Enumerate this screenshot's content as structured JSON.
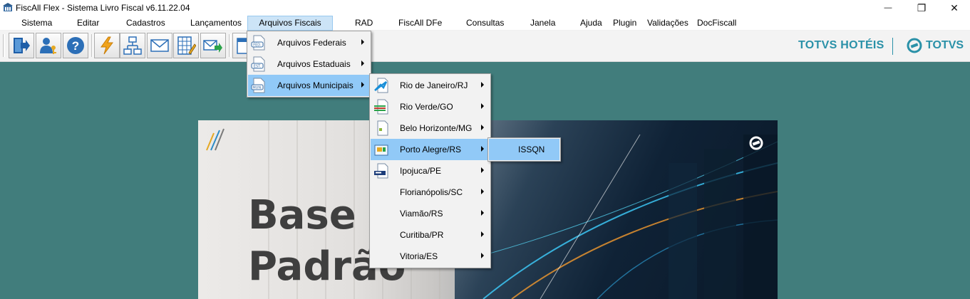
{
  "window": {
    "title": "FiscAll Flex - Sistema Livro Fiscal v6.11.22.04",
    "minimize_glyph": "—",
    "maximize_glyph": "❐",
    "close_glyph": "✕"
  },
  "menubar": {
    "items": [
      "Sistema",
      "Editar",
      "Cadastros",
      "Lançamentos",
      "Arquivos Fiscais",
      "RAD",
      "FiscAll DFe",
      "Consultas",
      "Janela",
      "Ajuda",
      "Plugin",
      "Validações",
      "DocFiscall"
    ],
    "active": "Arquivos Fiscais"
  },
  "toolbar": {
    "buttons": [
      "exit-icon",
      "user-key-icon",
      "help-icon",
      "lightning-icon",
      "network-icon",
      "mail-icon",
      "spreadsheet-edit-icon",
      "mail-send-icon",
      "calendar-icon"
    ]
  },
  "branding": {
    "left": "TOTVS HOTÉIS",
    "right": "TOTVS",
    "color": "#2a91a8"
  },
  "banner": {
    "line1": "Base",
    "line2": "Padrão"
  },
  "menus": {
    "arquivos_fiscais": [
      {
        "label": "Arquivos Federais",
        "icon": "FED."
      },
      {
        "label": "Arquivos Estaduais",
        "icon": "EST."
      },
      {
        "label": "Arquivos Municipais",
        "icon": "MUN."
      }
    ],
    "municipais": [
      "Rio de Janeiro/RJ",
      "Rio Verde/GO",
      "Belo Horizonte/MG",
      "Porto Alegre/RS",
      "Ipojuca/PE",
      "Florianópolis/SC",
      "Viamão/RS",
      "Curitiba/PR",
      "Vitoria/ES"
    ],
    "porto_alegre": [
      "ISSQN"
    ]
  },
  "colors": {
    "workspace": "#417d7c",
    "highlight": "#91c9f7",
    "menu_active": "#cce4f7"
  }
}
